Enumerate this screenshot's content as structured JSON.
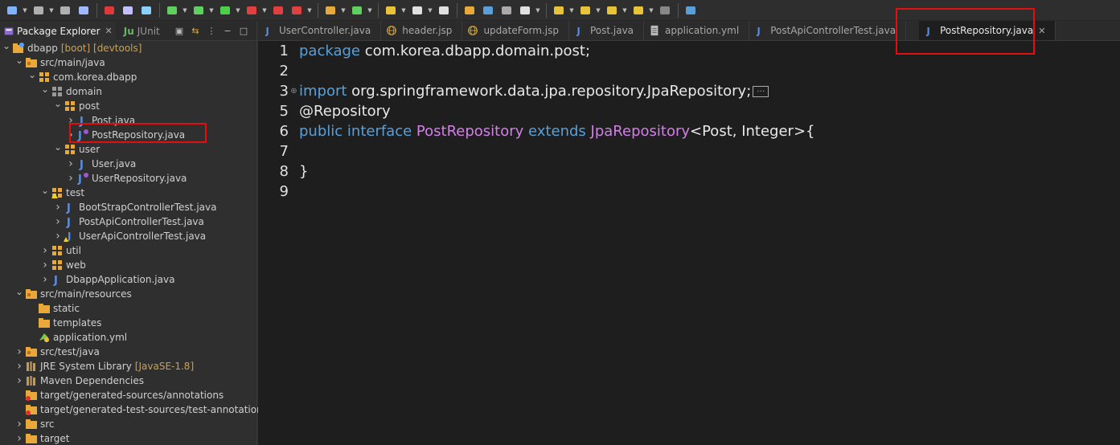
{
  "toolbar": {
    "icons": [
      "new-icon",
      "save-icon",
      "save-all-icon",
      "screen-icon",
      "gift-icon",
      "brush-icon",
      "hierarchy-icon",
      "spring-icon",
      "debug-icon",
      "run-icon",
      "run-external-icon",
      "stop-icon",
      "flag-icon",
      "build-icon",
      "refresh-icon",
      "open-type-icon",
      "search-icon",
      "toggle-mark-icon",
      "highlight-icon",
      "word-wrap-icon",
      "block-select-icon",
      "pilcrow-icon",
      "next-annotation-icon",
      "prev-annotation-icon",
      "last-edit-icon",
      "back-icon",
      "forward-icon",
      "pin-icon"
    ]
  },
  "left_panel": {
    "tabs": [
      {
        "label": "Package Explorer",
        "active": true
      },
      {
        "label": "JUnit",
        "active": false
      }
    ],
    "tree": [
      {
        "label": "dbapp",
        "suffix": "[boot] [devtools]",
        "icon": "project-icon",
        "depth": 0,
        "expanded": true
      },
      {
        "label": "src/main/java",
        "suffix": "",
        "icon": "source-folder-icon",
        "depth": 1,
        "expanded": true
      },
      {
        "label": "com.korea.dbapp",
        "suffix": "",
        "icon": "package-icon",
        "depth": 2,
        "expanded": true
      },
      {
        "label": "domain",
        "suffix": "",
        "icon": "package-empty-icon",
        "depth": 3,
        "expanded": true
      },
      {
        "label": "post",
        "suffix": "",
        "icon": "package-icon",
        "depth": 4,
        "expanded": true
      },
      {
        "label": "Post.java",
        "suffix": "",
        "icon": "java-file-icon",
        "depth": 5,
        "expanded": false
      },
      {
        "label": "PostRepository.java",
        "suffix": "",
        "icon": "java-interface-icon",
        "depth": 5,
        "expanded": false
      },
      {
        "label": "user",
        "suffix": "",
        "icon": "package-icon",
        "depth": 4,
        "expanded": true
      },
      {
        "label": "User.java",
        "suffix": "",
        "icon": "java-file-icon",
        "depth": 5,
        "expanded": false
      },
      {
        "label": "UserRepository.java",
        "suffix": "",
        "icon": "java-interface-icon",
        "depth": 5,
        "expanded": false
      },
      {
        "label": "test",
        "suffix": "",
        "icon": "package-warning-icon",
        "depth": 3,
        "expanded": true
      },
      {
        "label": "BootStrapControllerTest.java",
        "suffix": "",
        "icon": "java-file-icon",
        "depth": 4,
        "expanded": false
      },
      {
        "label": "PostApiControllerTest.java",
        "suffix": "",
        "icon": "java-file-icon",
        "depth": 4,
        "expanded": false
      },
      {
        "label": "UserApiControllerTest.java",
        "suffix": "",
        "icon": "java-file-warning-icon",
        "depth": 4,
        "expanded": false
      },
      {
        "label": "util",
        "suffix": "",
        "icon": "package-icon",
        "depth": 3,
        "expanded": false
      },
      {
        "label": "web",
        "suffix": "",
        "icon": "package-icon",
        "depth": 3,
        "expanded": false
      },
      {
        "label": "DbappApplication.java",
        "suffix": "",
        "icon": "java-file-icon",
        "depth": 3,
        "expanded": false
      },
      {
        "label": "src/main/resources",
        "suffix": "",
        "icon": "source-folder-icon",
        "depth": 1,
        "expanded": true
      },
      {
        "label": "static",
        "suffix": "",
        "icon": "folder-icon",
        "depth": 2,
        "expanded": null
      },
      {
        "label": "templates",
        "suffix": "",
        "icon": "folder-icon",
        "depth": 2,
        "expanded": null
      },
      {
        "label": "application.yml",
        "suffix": "",
        "icon": "yml-file-icon",
        "depth": 2,
        "expanded": null
      },
      {
        "label": "src/test/java",
        "suffix": "",
        "icon": "source-folder-icon",
        "depth": 1,
        "expanded": false
      },
      {
        "label": "JRE System Library",
        "suffix": "[JavaSE-1.8]",
        "icon": "library-icon",
        "depth": 1,
        "expanded": false
      },
      {
        "label": "Maven Dependencies",
        "suffix": "",
        "icon": "library-icon",
        "depth": 1,
        "expanded": false
      },
      {
        "label": "target/generated-sources/annotations",
        "suffix": "",
        "icon": "source-folder-error-icon",
        "depth": 1,
        "expanded": null
      },
      {
        "label": "target/generated-test-sources/test-annotations",
        "suffix": "",
        "icon": "source-folder-error-icon",
        "depth": 1,
        "expanded": null
      },
      {
        "label": "src",
        "suffix": "",
        "icon": "folder-icon",
        "depth": 1,
        "expanded": false
      },
      {
        "label": "target",
        "suffix": "",
        "icon": "folder-icon",
        "depth": 1,
        "expanded": false
      }
    ]
  },
  "editor": {
    "tabs": [
      {
        "label": "UserController.java",
        "icon": "java-file-icon",
        "active": false
      },
      {
        "label": "header.jsp",
        "icon": "jsp-file-icon",
        "active": false
      },
      {
        "label": "updateForm.jsp",
        "icon": "jsp-file-icon",
        "active": false
      },
      {
        "label": "Post.java",
        "icon": "java-file-icon",
        "active": false
      },
      {
        "label": "application.yml",
        "icon": "text-file-icon",
        "active": false
      },
      {
        "label": "PostApiControllerTest.java",
        "icon": "java-file-icon",
        "active": false
      },
      {
        "label": "PostRepository.java",
        "icon": "java-file-icon",
        "active": true
      }
    ],
    "lines": [
      {
        "num": "1",
        "fold": "",
        "tokens": [
          {
            "t": "package",
            "c": "kw"
          },
          {
            "t": " com.korea.dbapp.domain.post;",
            "c": ""
          }
        ]
      },
      {
        "num": "2",
        "fold": "",
        "tokens": []
      },
      {
        "num": "3",
        "fold": "⊕",
        "tokens": [
          {
            "t": "import",
            "c": "kw"
          },
          {
            "t": " org.springframework.data.jpa.repository.JpaRepository;",
            "c": ""
          }
        ],
        "collapsed": true
      },
      {
        "num": "5",
        "fold": "",
        "tokens": [
          {
            "t": "@Repository",
            "c": "an"
          }
        ]
      },
      {
        "num": "6",
        "fold": "",
        "tokens": [
          {
            "t": "public",
            "c": "kw"
          },
          {
            "t": " ",
            "c": ""
          },
          {
            "t": "interface",
            "c": "kw"
          },
          {
            "t": " ",
            "c": ""
          },
          {
            "t": "PostRepository",
            "c": "tp"
          },
          {
            "t": " ",
            "c": ""
          },
          {
            "t": "extends",
            "c": "kw"
          },
          {
            "t": " ",
            "c": ""
          },
          {
            "t": "JpaRepository",
            "c": "tp"
          },
          {
            "t": "<Post, Integer>{",
            "c": ""
          }
        ]
      },
      {
        "num": "7",
        "fold": "",
        "tokens": []
      },
      {
        "num": "8",
        "fold": "",
        "tokens": [
          {
            "t": "}",
            "c": ""
          }
        ]
      },
      {
        "num": "9",
        "fold": "",
        "tokens": []
      }
    ]
  },
  "colors": {
    "keyword": "#5aa0d8",
    "type": "#d180e6",
    "highlight_box": "#e01010",
    "suffix": "#c9a254"
  }
}
